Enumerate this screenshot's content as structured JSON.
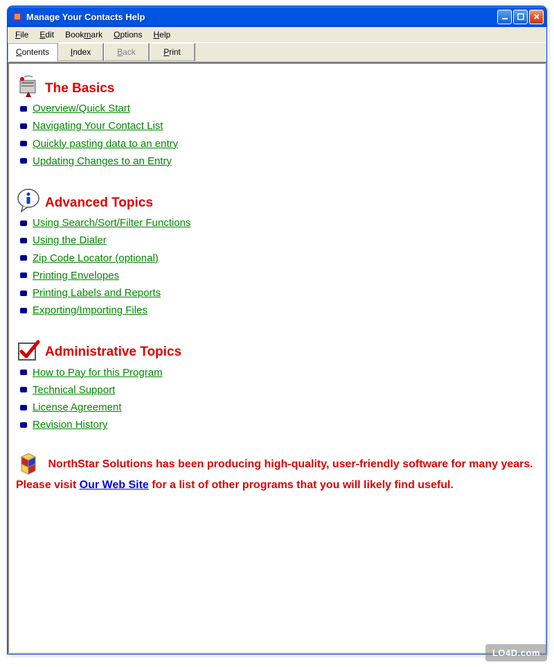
{
  "window": {
    "title": "Manage Your Contacts Help"
  },
  "menu": {
    "file": "File",
    "edit": "Edit",
    "bookmark": "Bookmark",
    "options": "Options",
    "help": "Help"
  },
  "toolbar": {
    "contents": "Contents",
    "index": "Index",
    "back": "Back",
    "print": "Print"
  },
  "sections": {
    "basics": {
      "title": "The Basics",
      "items": [
        "Overview/Quick Start",
        "Navigating Your Contact List",
        "Quickly pasting data to an entry",
        "Updating Changes to an Entry"
      ]
    },
    "advanced": {
      "title": "Advanced Topics",
      "items": [
        "Using Search/Sort/Filter Functions",
        "Using the Dialer",
        "Zip Code Locator (optional)",
        "Printing Envelopes",
        "Printing Labels and Reports",
        "Exporting/Importing Files"
      ]
    },
    "admin": {
      "title": "Administrative Topics",
      "items": [
        "How to Pay for this Program",
        "Technical Support",
        "License Agreement",
        "Revision History"
      ]
    }
  },
  "footer": {
    "text1": "NorthStar Solutions has been producing high-quality, user-friendly software for many years.  Please visit ",
    "link": "Our Web Site",
    "text2": " for a list of other programs that you will likely find useful."
  },
  "watermark": "LO4D.com"
}
